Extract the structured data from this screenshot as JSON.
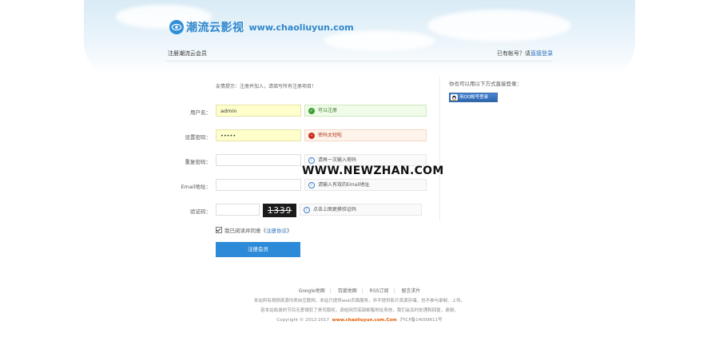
{
  "header": {
    "logo_cn": "潮流云影视",
    "logo_en": "www.chaoliuyun.com",
    "register_title": "注册潮流云会员",
    "have_account_text": "已有帐号？请",
    "login_link": "直接登录"
  },
  "form": {
    "tip": "友情提示：注册并加入，请填写所有注册项目！",
    "username": {
      "label": "用户名：",
      "value": "admin",
      "message": "可以注册"
    },
    "password": {
      "label": "设置密码：",
      "value": "•••••",
      "message": "密码太短啦"
    },
    "confirm_password": {
      "label": "重复密码：",
      "value": "",
      "message": "请再一次输入密码"
    },
    "email": {
      "label": "Email地址：",
      "value": "",
      "message": "请输入有效的Email地址"
    },
    "captcha": {
      "label": "验证码：",
      "value": "",
      "image_text": "1339",
      "message": "点击上图更换验证码"
    },
    "agree_text": "我已阅读并同意《",
    "agree_link": "注册协议",
    "agree_end": "》",
    "submit_label": "注册会员"
  },
  "side": {
    "other_login": "你也可以用以下方式直接登录：",
    "qq_button": "用QQ帐号登录"
  },
  "watermark": "WWW.NEWZHAN.COM",
  "footer": {
    "links": [
      "Google地图",
      "百度地图",
      "RSS订阅",
      "留言求片"
    ],
    "line1": "本站所有视频资源均来自互联网，本站只提供web页面服务，并不提供影片资源存储，也不参与录制、上传。",
    "line2": "若本站收录的节目无意侵犯了贵司版权，请给网页底部邮箱地址来信，我们会及时处理和回复，谢谢。",
    "copyright_prefix": "Copyright © 2012-2017",
    "copyright_brand": "www.chaoliuyun.com.Com",
    "icp": "沪ICP备14009611号"
  },
  "colors": {
    "accent": "#2c8ad8",
    "link": "#2a6fb8",
    "ok": "#3a9e2f",
    "error": "#c9331e",
    "brand_orange": "#e05a00"
  }
}
